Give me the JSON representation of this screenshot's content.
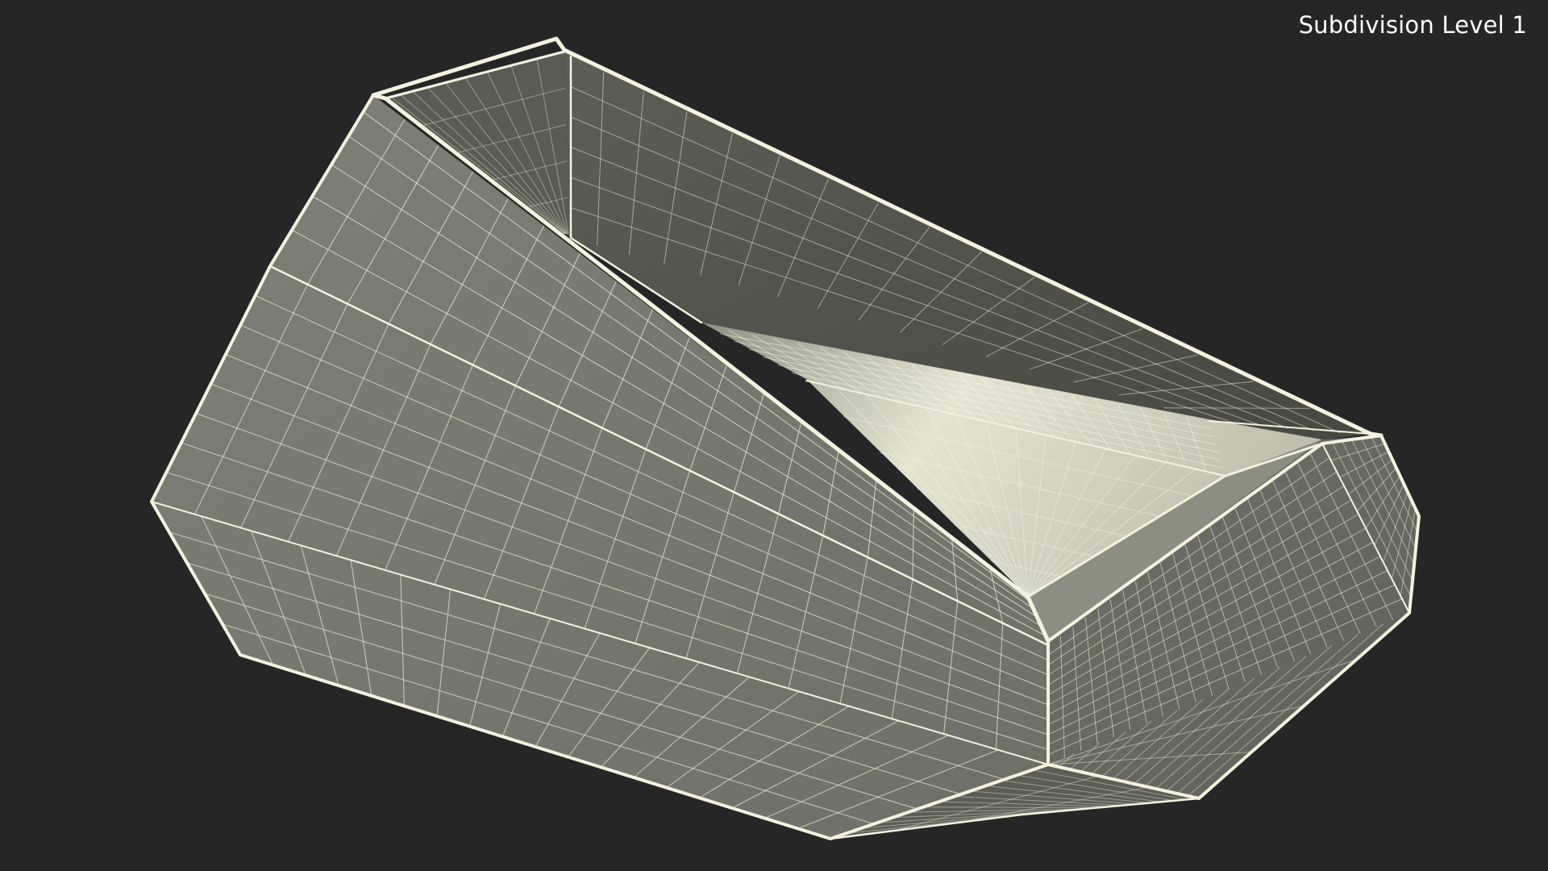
{
  "viewport": {
    "subdivision_label": "Subdivision Level 1",
    "background_color": "#262626"
  },
  "model": {
    "render_style": "wireframe-on-shaded",
    "object": "faceted-lounge-chair",
    "colors": {
      "side_face": "#77786f",
      "side_face_light": "#828377",
      "inner_back": "#55564d",
      "inner_back_dark": "#3f4038",
      "inner_left": "#6b6c62",
      "seat": "#c9c9b6",
      "seat_highlight": "#e8e8d6",
      "front_face": "#6a6b62",
      "bottom_face": "#5e5f57",
      "edge": "#f3f2de",
      "grid_line": "#e9e8d4"
    }
  }
}
